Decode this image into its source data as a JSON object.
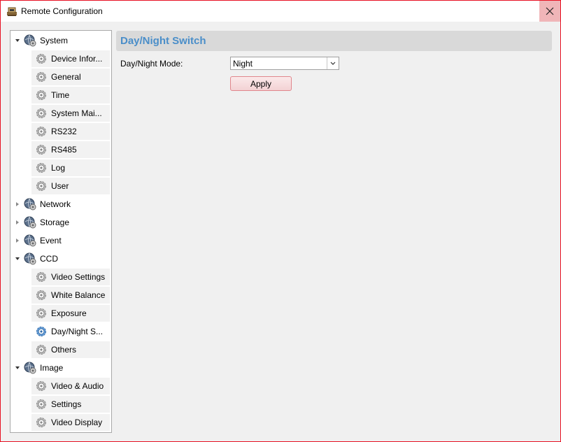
{
  "window": {
    "title": "Remote Configuration",
    "app_icon": "remote-config-app-icon",
    "close_icon": "close-icon",
    "accent_color": "#e81123"
  },
  "tree": {
    "items": [
      {
        "label": "System",
        "level": 0,
        "expanded": true,
        "icon": "globe-gear-icon"
      },
      {
        "label": "Device Infor...",
        "level": 1,
        "icon": "gear-icon"
      },
      {
        "label": "General",
        "level": 1,
        "icon": "gear-icon"
      },
      {
        "label": "Time",
        "level": 1,
        "icon": "gear-icon"
      },
      {
        "label": "System Mai...",
        "level": 1,
        "icon": "gear-icon"
      },
      {
        "label": "RS232",
        "level": 1,
        "icon": "gear-icon"
      },
      {
        "label": "RS485",
        "level": 1,
        "icon": "gear-icon"
      },
      {
        "label": "Log",
        "level": 1,
        "icon": "gear-icon"
      },
      {
        "label": "User",
        "level": 1,
        "icon": "gear-icon"
      },
      {
        "label": "Network",
        "level": 0,
        "expanded": false,
        "icon": "globe-gear-icon"
      },
      {
        "label": "Storage",
        "level": 0,
        "expanded": false,
        "icon": "globe-gear-icon"
      },
      {
        "label": "Event",
        "level": 0,
        "expanded": false,
        "icon": "globe-gear-icon"
      },
      {
        "label": "CCD",
        "level": 0,
        "expanded": true,
        "icon": "globe-gear-icon"
      },
      {
        "label": "Video Settings",
        "level": 1,
        "icon": "gear-icon"
      },
      {
        "label": "White Balance",
        "level": 1,
        "icon": "gear-icon"
      },
      {
        "label": "Exposure",
        "level": 1,
        "icon": "gear-icon"
      },
      {
        "label": "Day/Night S...",
        "level": 1,
        "icon": "gear-icon",
        "selected": true
      },
      {
        "label": "Others",
        "level": 1,
        "icon": "gear-icon"
      },
      {
        "label": "Image",
        "level": 0,
        "expanded": true,
        "icon": "globe-gear-icon"
      },
      {
        "label": "Video & Audio",
        "level": 1,
        "icon": "gear-icon"
      },
      {
        "label": "Settings",
        "level": 1,
        "icon": "gear-icon"
      },
      {
        "label": "Video Display",
        "level": 1,
        "icon": "gear-icon"
      }
    ]
  },
  "panel": {
    "title": "Day/Night Switch",
    "title_color": "#4a8ec9",
    "mode_label": "Day/Night Mode:",
    "mode_value": "Night",
    "apply_label": "Apply"
  }
}
